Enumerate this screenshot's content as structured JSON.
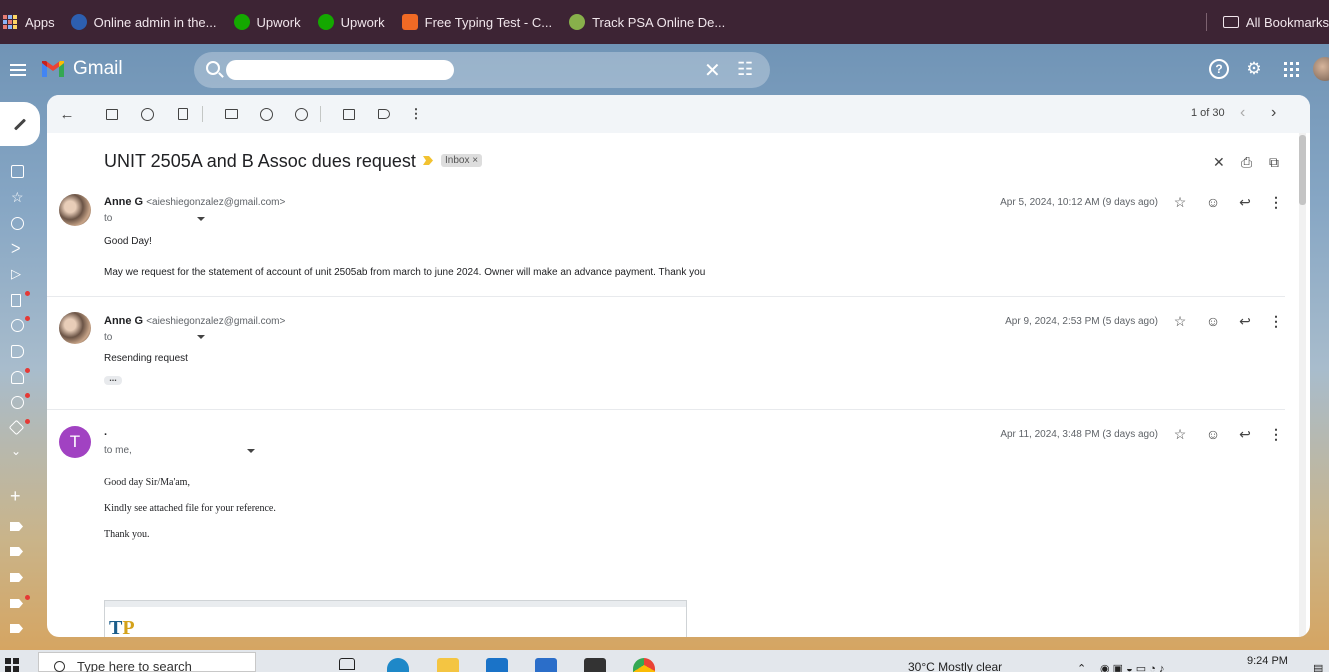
{
  "bookmarks": {
    "apps": "Apps",
    "items": [
      {
        "label": "Online admin in the...",
        "icon": "online-admin-icon",
        "color": "#2d5fb0"
      },
      {
        "label": "Upwork",
        "icon": "upwork-icon",
        "color": "#14a800"
      },
      {
        "label": "Upwork",
        "icon": "upwork-icon",
        "color": "#14a800"
      },
      {
        "label": "Free Typing Test - C...",
        "icon": "typing-test-icon",
        "color": "#f06a25"
      },
      {
        "label": "Track PSA Online De...",
        "icon": "psa-icon",
        "color": "#88b04b"
      }
    ],
    "all_bookmarks": "All Bookmarks"
  },
  "header": {
    "app_name": "Gmail",
    "search_value": "",
    "brand_colors": [
      "#ea4335",
      "#fbbc04",
      "#34a853",
      "#4285f4"
    ]
  },
  "toolbar": {
    "pager": "1 of 30"
  },
  "thread": {
    "subject": "UNIT 2505A and B Assoc dues request",
    "label_chip": "Inbox",
    "messages": [
      {
        "sender": "Anne G",
        "email": "<aieshiegonzalez@gmail.com>",
        "to": "to",
        "date": "Apr 5, 2024, 10:12 AM (9 days ago)",
        "body": [
          "Good Day!",
          "May we request for the statement of account of unit 2505ab from march to june 2024. Owner will make an advance payment. Thank you"
        ]
      },
      {
        "sender": "Anne G",
        "email": "<aieshiegonzalez@gmail.com>",
        "to": "to",
        "date": "Apr 9, 2024, 2:53 PM (5 days ago)",
        "body": [
          "Resending request"
        ]
      },
      {
        "avatar_letter": "T",
        "avatar_color": "#a142c2",
        "sender": ".",
        "to": "to me,",
        "date": "Apr 11, 2024, 3:48 PM (3 days ago)",
        "body": [
          "Good day Sir/Ma'am,",
          "Kindly see attached file for your reference.",
          "Thank you."
        ]
      }
    ]
  },
  "taskbar": {
    "search_placeholder": "Type here to search",
    "weather": "30°C  Mostly clear",
    "time": "9:24 PM"
  }
}
